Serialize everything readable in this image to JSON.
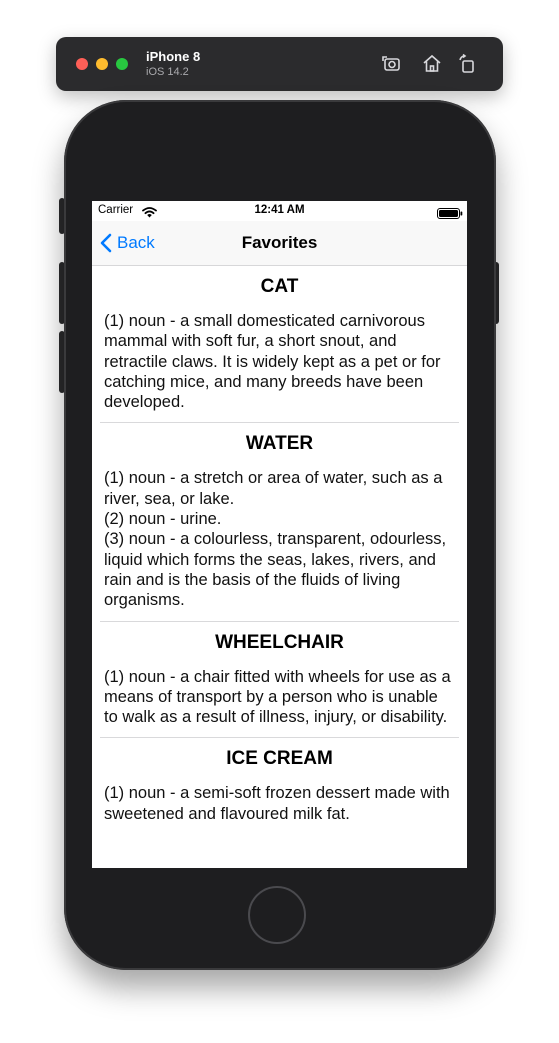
{
  "simulator": {
    "device": "iPhone 8",
    "os": "iOS 14.2",
    "icons": [
      "screenshot-icon",
      "home-icon",
      "rotate-icon"
    ]
  },
  "status_bar": {
    "carrier": "Carrier",
    "time": "12:41 AM"
  },
  "navbar": {
    "back_label": "Back",
    "title": "Favorites"
  },
  "entries": [
    {
      "word": "CAT",
      "definition": "(1) noun - a small domesticated carnivorous mammal with soft fur, a short snout, and retractile claws. It is widely kept as a pet or for catching mice, and many breeds have been developed."
    },
    {
      "word": "WATER",
      "definition": "(1) noun - a stretch or area of water, such as a river, sea, or lake.\n(2) noun - urine.\n(3) noun - a colourless, transparent, odourless, liquid which forms the seas, lakes, rivers, and rain and is the basis of the fluids of living organisms."
    },
    {
      "word": "WHEELCHAIR",
      "definition": "(1) noun - a chair fitted with wheels for use as a means of transport by a person who is unable to walk as a result of illness, injury, or disability."
    },
    {
      "word": "ICE CREAM",
      "definition": "(1) noun - a semi-soft frozen dessert made with sweetened and flavoured milk fat."
    }
  ],
  "colors": {
    "accent": "#007aff",
    "phone_body": "#1e1e20",
    "sim_bar": "#2b2b2d"
  }
}
